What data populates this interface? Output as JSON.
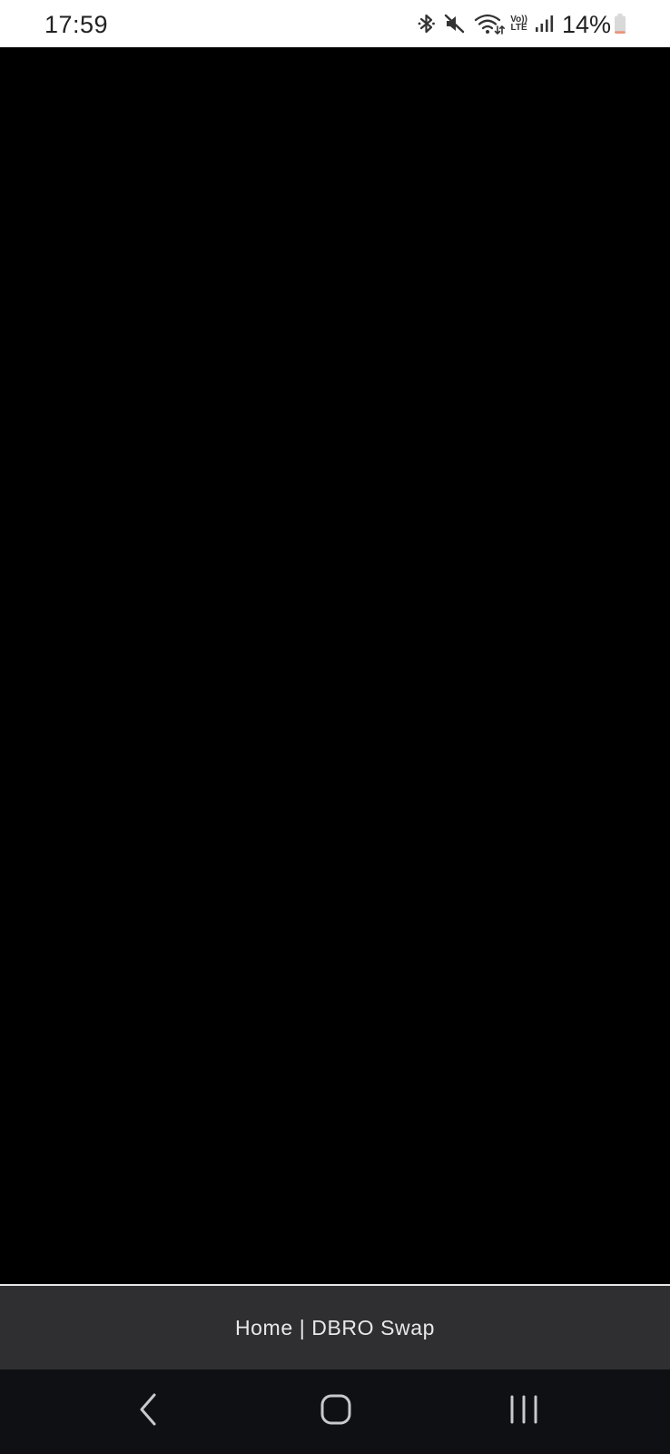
{
  "status_bar": {
    "time": "17:59",
    "icons": [
      "bluetooth-icon",
      "mute-icon",
      "wifi-icon",
      "volte-icon",
      "signal-icon"
    ],
    "volte_top": "Vo))",
    "volte_bottom": "LTE",
    "battery_percent_text": "14%",
    "battery_level": 0.14,
    "battery_low_color": "#e8957b"
  },
  "browser": {
    "page_title": "Home | DBRO Swap"
  },
  "navigation": {
    "buttons": [
      "back-icon",
      "home-icon",
      "recents-icon"
    ]
  },
  "colors": {
    "content_background": "#000000",
    "title_bar_background": "#2f2f31",
    "nav_bar_background": "#0f1013"
  }
}
